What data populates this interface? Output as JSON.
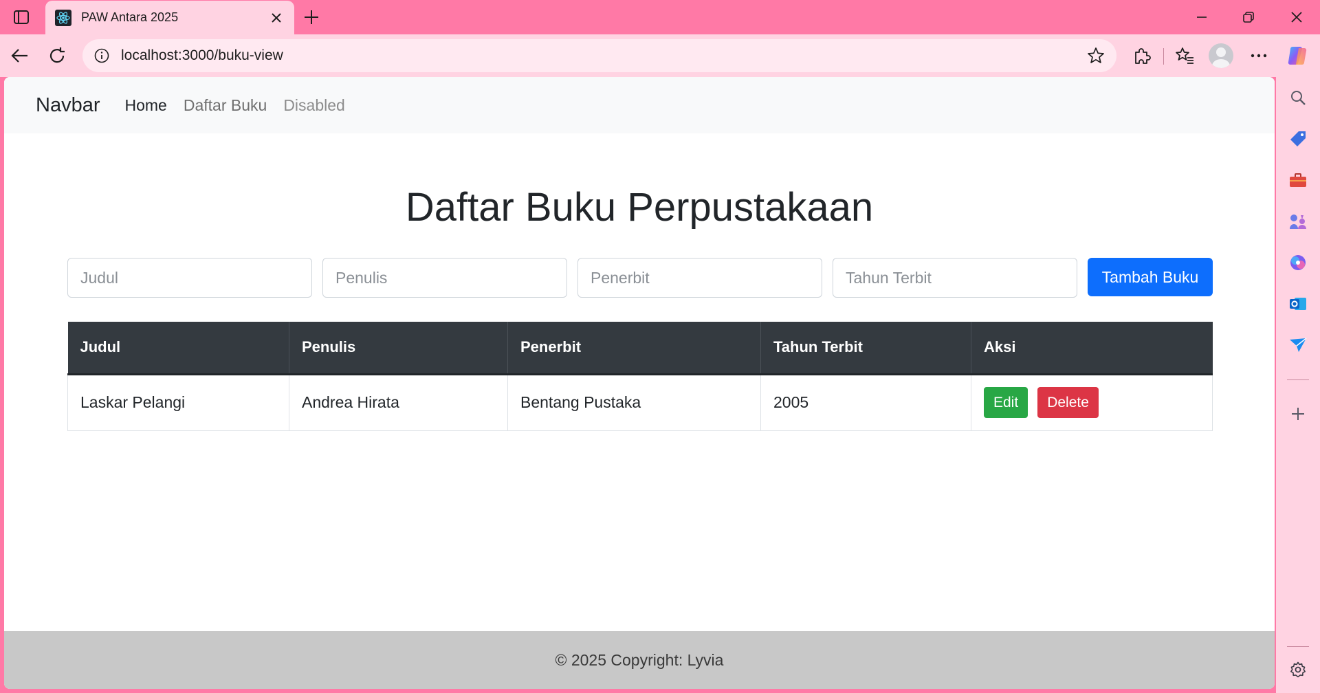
{
  "browser": {
    "tab_title": "PAW Antara 2025",
    "url": "localhost:3000/buku-view"
  },
  "navbar": {
    "brand": "Navbar",
    "links": [
      {
        "label": "Home",
        "state": "active"
      },
      {
        "label": "Daftar Buku",
        "state": "normal"
      },
      {
        "label": "Disabled",
        "state": "disabled"
      }
    ]
  },
  "main": {
    "title": "Daftar Buku Perpustakaan",
    "form": {
      "judul_placeholder": "Judul",
      "penulis_placeholder": "Penulis",
      "penerbit_placeholder": "Penerbit",
      "tahun_placeholder": "Tahun Terbit",
      "add_button": "Tambah Buku"
    },
    "table": {
      "headers": [
        "Judul",
        "Penulis",
        "Penerbit",
        "Tahun Terbit",
        "Aksi"
      ],
      "rows": [
        {
          "judul": "Laskar Pelangi",
          "penulis": "Andrea Hirata",
          "penerbit": "Bentang Pustaka",
          "tahun": "2005"
        }
      ],
      "edit_label": "Edit",
      "delete_label": "Delete"
    }
  },
  "footer": {
    "text": "© 2025 Copyright: Lyvia"
  },
  "colors": {
    "chrome": "#ff79a6",
    "chrome_light": "#ffd3e2",
    "primary": "#0d6efd",
    "success": "#28a745",
    "danger": "#dc3545",
    "table_head": "#343a40",
    "footer": "#c8c8c8"
  },
  "icons": {
    "tab_actions": "tab-actions-icon",
    "favicon": "react-icon",
    "tab_close": "close-icon",
    "new_tab": "plus-icon",
    "back": "back-arrow-icon",
    "reload": "reload-icon",
    "site_info": "info-icon",
    "favorite": "star-icon",
    "extensions": "puzzle-icon",
    "favorites": "favorites-icon",
    "more": "more-icon",
    "copilot": "copilot-icon",
    "sidebar": [
      "search-icon",
      "tag-icon",
      "toolbox-icon",
      "games-icon",
      "copilot-apps-icon",
      "outlook-icon",
      "send-icon",
      "add-icon",
      "settings-icon"
    ]
  }
}
